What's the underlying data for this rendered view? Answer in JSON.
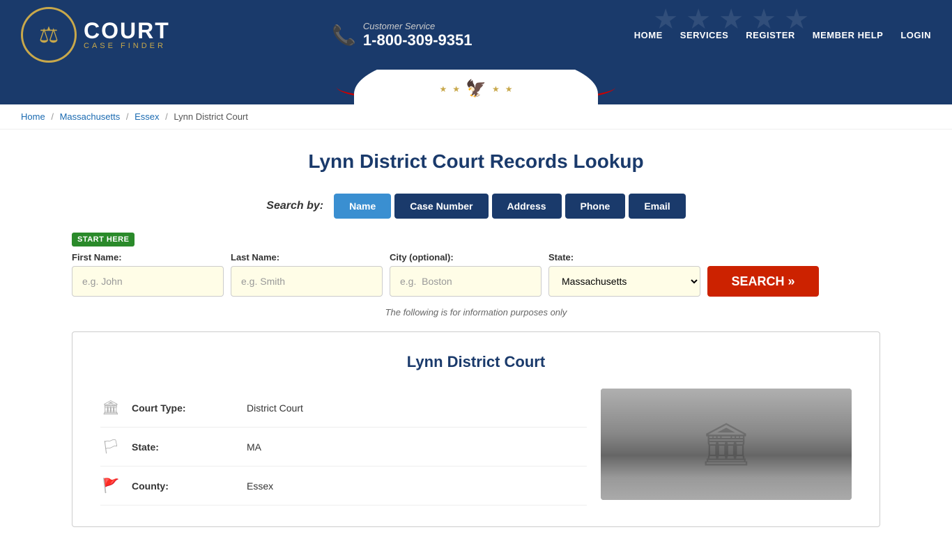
{
  "header": {
    "logo_court": "COURT",
    "logo_sub": "CASE FINDER",
    "phone_label": "Customer Service",
    "phone_number": "1-800-309-9351",
    "nav": [
      {
        "label": "HOME",
        "href": "#"
      },
      {
        "label": "SERVICES",
        "href": "#"
      },
      {
        "label": "REGISTER",
        "href": "#"
      },
      {
        "label": "MEMBER HELP",
        "href": "#"
      },
      {
        "label": "LOGIN",
        "href": "#"
      }
    ]
  },
  "breadcrumb": {
    "items": [
      {
        "label": "Home",
        "href": "#"
      },
      {
        "label": "Massachusetts",
        "href": "#"
      },
      {
        "label": "Essex",
        "href": "#"
      },
      {
        "label": "Lynn District Court",
        "href": null
      }
    ]
  },
  "page": {
    "title": "Lynn District Court Records Lookup"
  },
  "search": {
    "by_label": "Search by:",
    "tabs": [
      {
        "label": "Name",
        "active": true
      },
      {
        "label": "Case Number",
        "active": false
      },
      {
        "label": "Address",
        "active": false
      },
      {
        "label": "Phone",
        "active": false
      },
      {
        "label": "Email",
        "active": false
      }
    ],
    "start_here": "START HERE",
    "fields": {
      "first_name_label": "First Name:",
      "first_name_placeholder": "e.g. John",
      "last_name_label": "Last Name:",
      "last_name_placeholder": "e.g. Smith",
      "city_label": "City (optional):",
      "city_placeholder": "e.g.  Boston",
      "state_label": "State:",
      "state_value": "Massachusetts"
    },
    "search_button": "SEARCH »",
    "info_note": "The following is for information purposes only"
  },
  "court_card": {
    "title": "Lynn District Court",
    "details": [
      {
        "icon": "🏛",
        "label": "Court Type:",
        "value": "District Court"
      },
      {
        "icon": "🏳",
        "label": "State:",
        "value": "MA"
      },
      {
        "icon": "🚩",
        "label": "County:",
        "value": "Essex"
      }
    ]
  }
}
